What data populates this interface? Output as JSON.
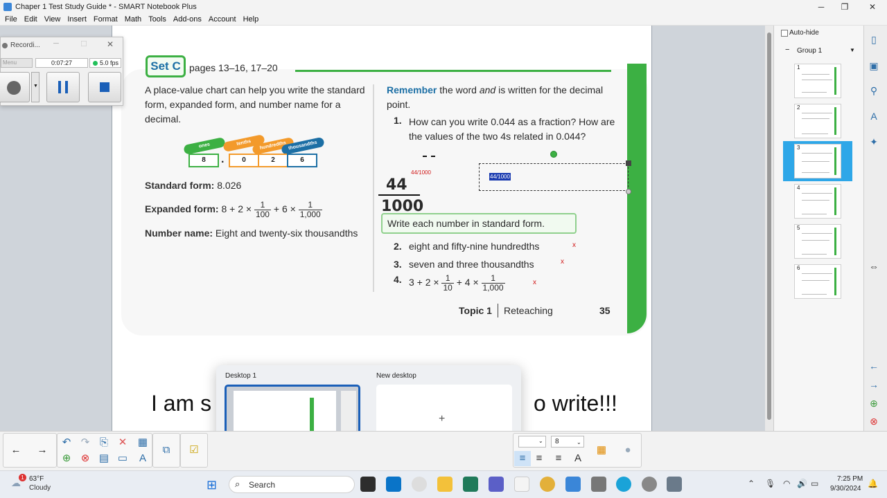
{
  "window": {
    "title": "Chaper 1 Test Study Guide * - SMART Notebook Plus",
    "minimize": "─",
    "maximize": "❐",
    "close": "✕"
  },
  "menu": [
    "File",
    "Edit",
    "View",
    "Insert",
    "Format",
    "Math",
    "Tools",
    "Add-ons",
    "Account",
    "Help"
  ],
  "recorder": {
    "title": "Recordi...",
    "menu_label": "Menu",
    "time": "0:07:27",
    "fps": "5.0 fps"
  },
  "page": {
    "set_label": "Set C",
    "pages_ref": "pages 13–16, 17–20",
    "intro": "A place-value chart can help you write the standard form, expanded form, and number name for a decimal.",
    "pv_tags": [
      "ones",
      "tenths",
      "hundredths",
      "thousandths"
    ],
    "pv_digits": [
      "8",
      ".",
      "0",
      "2",
      "6"
    ],
    "standard_label": "Standard form:",
    "standard_value": "8.026",
    "expanded_label": "Expanded form:",
    "expanded_value": "8 + 2 ×",
    "expanded_mid": "+ 6 ×",
    "frac_1_num": "1",
    "frac_1_den": "100",
    "frac_2_num": "1",
    "frac_2_den": "1,000",
    "number_label": "Number name:",
    "number_value": "Eight and twenty-six thousandths",
    "remember_label": "Remember",
    "remember_text": "the word",
    "remember_word": "and",
    "remember_tail": "is written for the decimal point.",
    "q1_num": "1.",
    "q1_text": "How can you write 0.044 as a fraction? How are the values of the two 4s related in 0.044?",
    "handwritten_small": "44/1000",
    "handwritten_num": "44",
    "handwritten_den": "1000",
    "selected_text": "44/1000",
    "write_heading": "Write each number in standard form.",
    "q2_num": "2.",
    "q2_text": "eight and fifty-nine hundredths",
    "q3_num": "3.",
    "q3_text": "seven and three thousandths",
    "q4_num": "4.",
    "q4_pre": "3 + 2 ×",
    "q4_mid": "+ 4 ×",
    "q4_f1_num": "1",
    "q4_f1_den": "10",
    "q4_f2_num": "1",
    "q4_f2_den": "1,000",
    "x_mark": "x",
    "topic": "Topic 1",
    "reteaching": "Reteaching",
    "page_number": "35"
  },
  "subtitle": {
    "left": "I am s",
    "right": "o write!!!"
  },
  "taskview": {
    "desktop1": "Desktop 1",
    "new_desktop": "New desktop",
    "plus": "+"
  },
  "side_panel": {
    "autohide": "Auto-hide",
    "group_label": "Group 1",
    "thumbnails": [
      "1",
      "2",
      "3",
      "4",
      "5",
      "6"
    ],
    "selected_index": 3
  },
  "toolbar": {
    "font_size": "8"
  },
  "taskbar": {
    "weather_temp": "63°F",
    "weather_desc": "Cloudy",
    "weather_badge": "1",
    "search_placeholder": "Search",
    "time": "7:25 PM",
    "date": "9/30/2024"
  },
  "colors": {
    "accent_green": "#3cb043",
    "title_blue": "#1c6fa5",
    "selection_blue": "#2ea7e8",
    "mark_red": "#d01818"
  }
}
